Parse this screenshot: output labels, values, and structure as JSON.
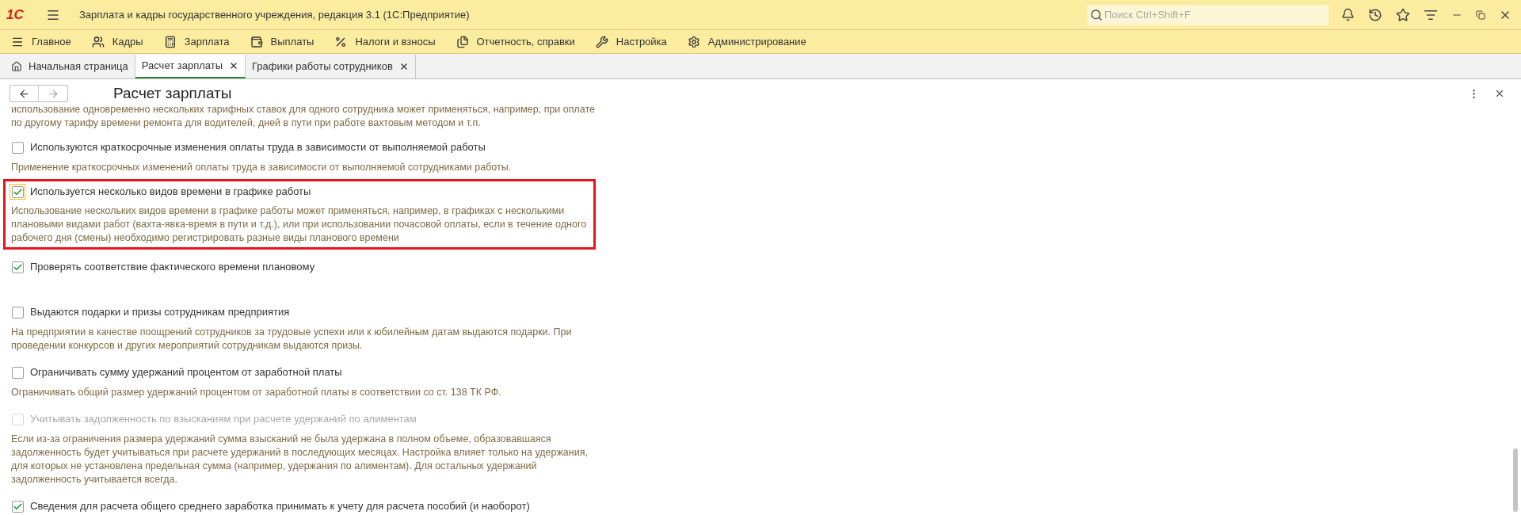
{
  "window": {
    "title": "Зарплата и кадры государственного учреждения, редакция 3.1  (1С:Предприятие)",
    "logo": "1С",
    "search": {
      "placeholder": "Поиск Ctrl+Shift+F"
    }
  },
  "menu": [
    "Главное",
    "Кадры",
    "Зарплата",
    "Выплаты",
    "Налоги и взносы",
    "Отчетность, справки",
    "Настройка",
    "Администрирование"
  ],
  "tabs": [
    {
      "label": "Начальная страница",
      "selected": false,
      "closable": false
    },
    {
      "label": "Расчет зарплаты",
      "selected": true,
      "closable": true
    },
    {
      "label": "Графики работы сотрудников",
      "selected": false,
      "closable": true
    }
  ],
  "form": {
    "title": "Расчет зарплаты",
    "items": [
      {
        "kind": "text",
        "text": "использование одновременно нескольких тарифных ставок для одного сотрудника может применяться, например, при оплате по другому тарифу времени ремонта для водителей, дней в пути при работе вахтовым методом и т.п."
      },
      {
        "kind": "checkbox",
        "label": "Используются краткосрочные изменения оплаты труда в зависимости от выполняемой работы",
        "checked": false,
        "disabled": false,
        "focused": false,
        "highlighted": false,
        "description": "Применение краткосрочных изменений оплаты труда в зависимости от выполняемой сотрудниками работы."
      },
      {
        "kind": "checkbox",
        "label": "Используется несколько видов времени в графике работы",
        "checked": true,
        "disabled": false,
        "focused": true,
        "highlighted": true,
        "description": "Использование нескольких видов времени в графике работы может применяться, например, в графиках с несколькими плановыми видами работ (вахта-явка-время в пути и т.д.), или при использовании почасовой оплаты, если в течение одного рабочего дня (смены) необходимо регистрировать разные виды планового времени"
      },
      {
        "kind": "checkbox",
        "label": "Проверять соответствие фактического времени плановому",
        "checked": true,
        "disabled": false,
        "focused": false,
        "highlighted": false
      },
      {
        "kind": "checkbox",
        "label": "Выдаются подарки и призы сотрудникам предприятия",
        "checked": false,
        "disabled": false,
        "focused": false,
        "highlighted": false,
        "description": "На предприятии в качестве поощрений сотрудников за трудовые успехи или к юбилейным датам выдаются подарки. При проведении конкурсов и других мероприятий сотрудникам выдаются призы."
      },
      {
        "kind": "checkbox",
        "label": "Ограничивать сумму удержаний процентом от заработной платы",
        "checked": false,
        "disabled": false,
        "focused": false,
        "highlighted": false,
        "description": "Ограничивать общий размер удержаний процентом от заработной платы в соответствии со ст. 138 ТК РФ."
      },
      {
        "kind": "checkbox",
        "label": "Учитывать задолженность по взысканиям при расчете удержаний по алиментам",
        "checked": false,
        "disabled": true,
        "focused": false,
        "highlighted": false,
        "description": "Если из-за ограничения размера удержаний сумма взысканий не была удержана в полном объеме, образовавшаяся задолженность будет учитываться при расчете удержаний в последующих месяцах. Настройка влияет только на удержания, для которых не установлена предельная сумма (например, удержания по алиментам). Для остальных удержаний задолженность учитывается всегда."
      },
      {
        "kind": "checkbox",
        "label": "Сведения для расчета общего среднего заработка принимать к учету для расчета пособий (и наоборот)",
        "checked": true,
        "disabled": false,
        "focused": false,
        "highlighted": false
      }
    ]
  }
}
